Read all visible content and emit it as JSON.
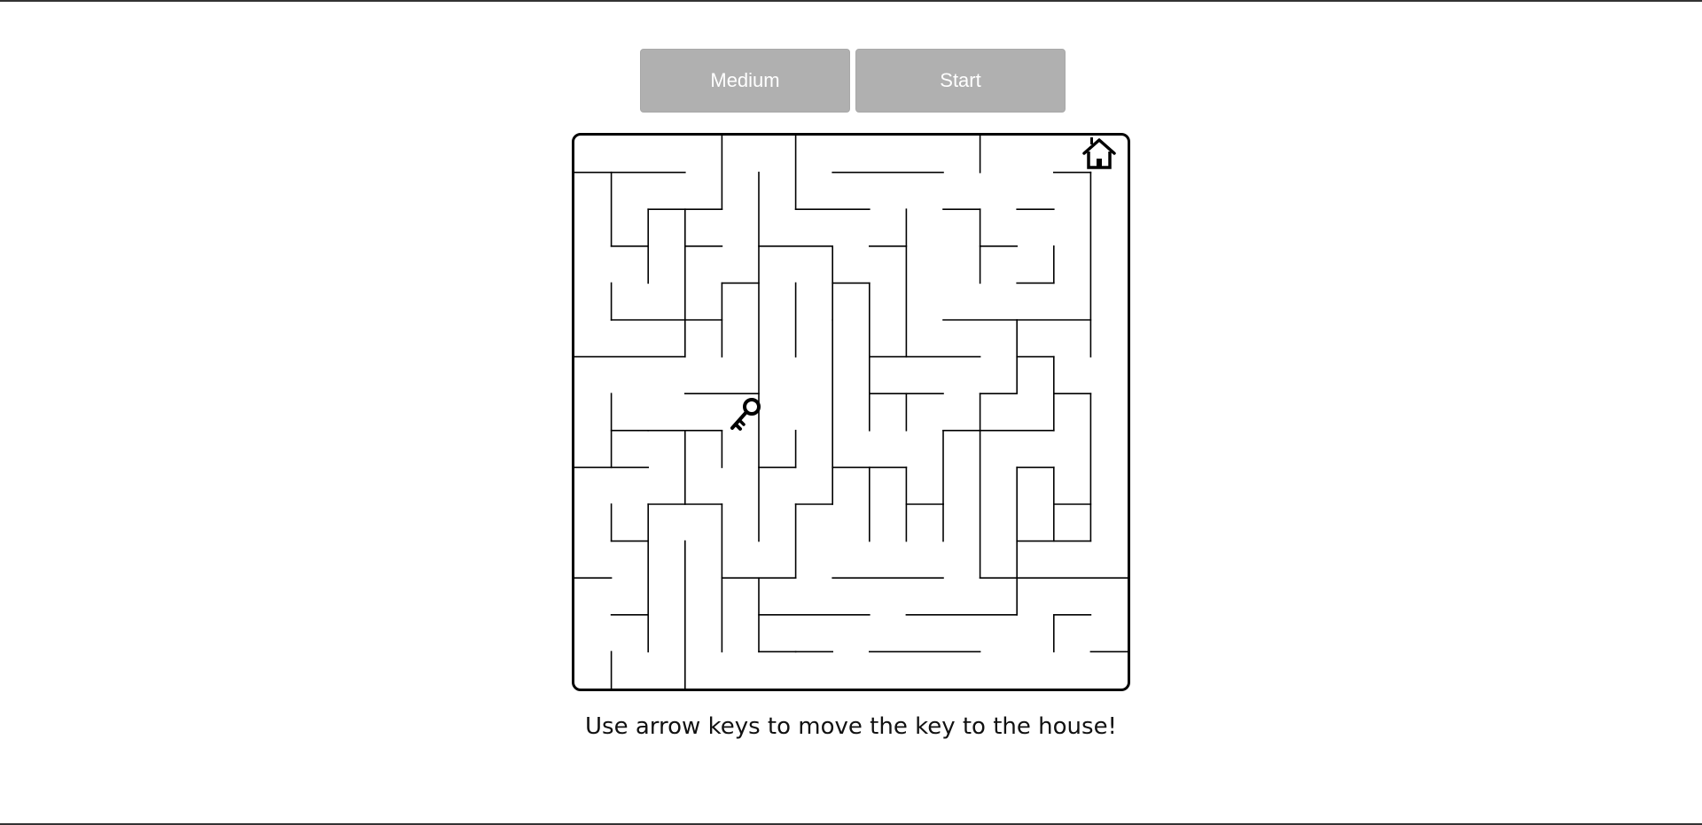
{
  "controls": {
    "difficulty_label": "Medium",
    "start_label": "Start"
  },
  "maze": {
    "player_icon": "key-icon",
    "goal_icon": "house-icon"
  },
  "instructions": "Use arrow keys to move the key to the house!"
}
